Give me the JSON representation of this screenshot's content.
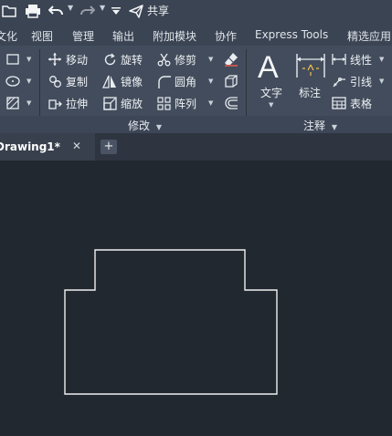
{
  "quick_access": {
    "share_label": "共享",
    "icons": [
      "folder-open-icon",
      "print-icon",
      "undo-icon",
      "redo-icon",
      "customize-dropdown-icon",
      "share-icon"
    ]
  },
  "menu_tabs": [
    "文化",
    "视图",
    "管理",
    "输出",
    "附加模块",
    "协作",
    "Express Tools",
    "精选应用"
  ],
  "ribbon": {
    "modify_panel": {
      "row1": [
        "移动",
        "旋转",
        "修剪"
      ],
      "row2": [
        "复制",
        "镜像",
        "圆角"
      ],
      "row3": [
        "拉伸",
        "缩放",
        "阵列"
      ],
      "label": "修改"
    },
    "annotation_panel": {
      "text_label": "文字",
      "dimension_label": "标注",
      "linear_label": "线性",
      "leader_label": "引线",
      "table_label": "表格",
      "label": "注释"
    }
  },
  "document": {
    "tab_name": "Drawing1*",
    "close_symbol": "✕",
    "new_tab_symbol": "+"
  },
  "colors": {
    "canvas_background": "#212830",
    "ribbon_background": "#424c5c",
    "toolbar_background": "#3b4453",
    "drawing_line": "#f0f0f0"
  }
}
